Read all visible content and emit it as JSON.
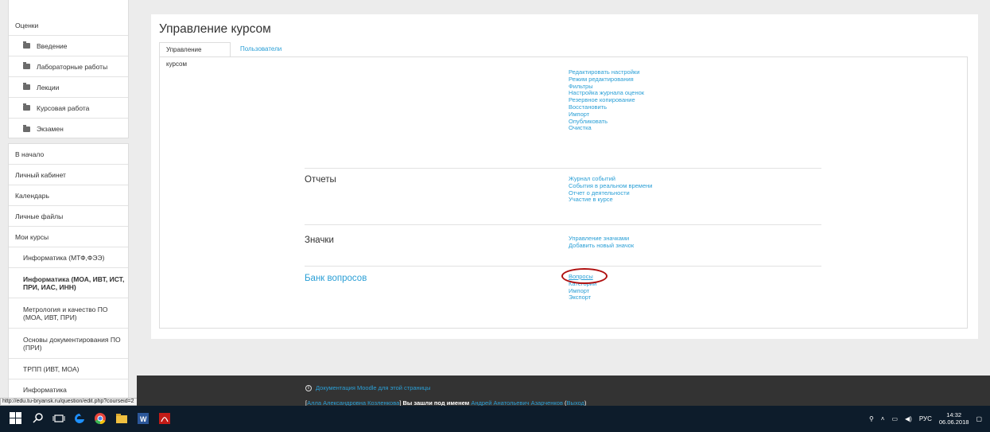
{
  "sidebar": {
    "block1_items": [
      {
        "label": "Оценки",
        "folder": false,
        "indent": false
      },
      {
        "label": "Введение",
        "folder": true
      },
      {
        "label": "Лабораторные работы",
        "folder": true
      },
      {
        "label": "Лекции",
        "folder": true
      },
      {
        "label": "Курсовая работа",
        "folder": true
      },
      {
        "label": "Экзамен",
        "folder": true
      }
    ],
    "nav": {
      "home": "В начало",
      "dashboard": "Личный кабинет",
      "calendar": "Календарь",
      "files": "Личные файлы",
      "mycourses": "Мои курсы",
      "courses": [
        "Информатика (МТФ,ФЭЭ)",
        "Информатика (МОА, ИВТ, ИСТ, ПРИ, ИАС, ИНН)",
        "Метрология и качество ПО (МОА, ИВТ, ПРИ)",
        "Основы документирования ПО (ПРИ)",
        "ТРПП (ИВТ, МОА)",
        "Информатика"
      ]
    }
  },
  "statusbar": "http://edu.tu-bryansk.ru/question/edit.php?courseid=2",
  "main": {
    "title": "Управление курсом",
    "tabs": [
      "Управление курсом",
      "Пользователи"
    ],
    "sections": {
      "course_links": [
        "Редактировать настройки",
        "Режим редактирования",
        "Фильтры",
        "Настройка журнала оценок",
        "Резервное копирование",
        "Восстановить",
        "Импорт",
        "Опубликовать",
        "Очистка"
      ],
      "reports_title": "Отчеты",
      "reports_links": [
        "Журнал событий",
        "События в реальном времени",
        "Отчет о деятельности",
        "Участие в курсе"
      ],
      "badges_title": "Значки",
      "badges_links": [
        "Управление значками",
        "Добавить новый значок"
      ],
      "qbank_title": "Банк вопросов",
      "qbank_links": [
        "Вопросы",
        "Категории",
        "Импорт",
        "Экспорт"
      ]
    }
  },
  "footer": {
    "docs_link": "Документация Moodle для этой страницы",
    "user_a": "Алла Александровна Козленкова",
    "logged_in_as": "Вы зашли под именем",
    "user_b": "Андрей Анатольевич Азарченков",
    "logout": "Выход"
  },
  "taskbar": {
    "lang": "РУС",
    "time": "14:32",
    "date": "06.06.2018"
  }
}
